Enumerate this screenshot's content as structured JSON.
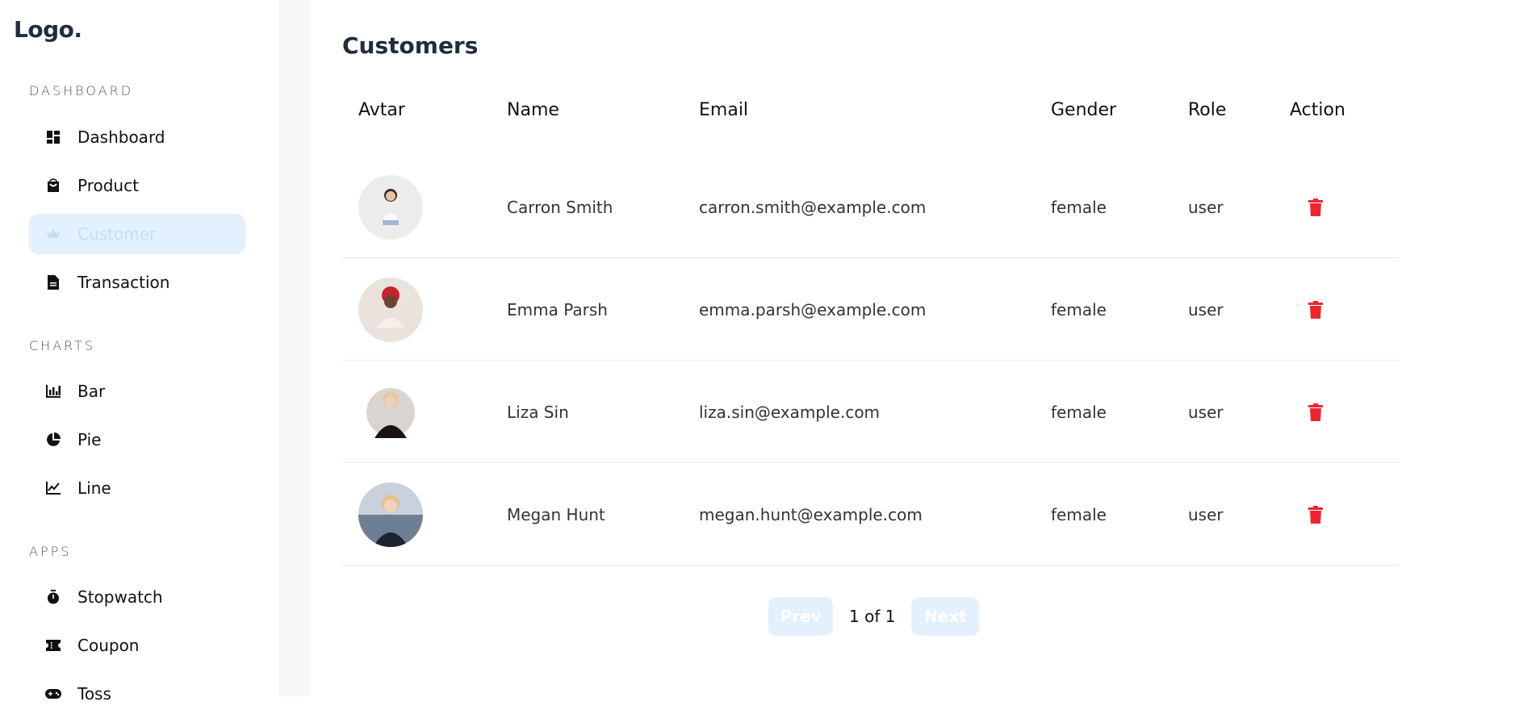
{
  "sidebar": {
    "logo": "Logo.",
    "sections": [
      {
        "heading": "DASHBOARD",
        "items": [
          {
            "label": "Dashboard",
            "icon": "dashboard-icon"
          },
          {
            "label": "Product",
            "icon": "shopping-bag-icon"
          },
          {
            "label": "Customer",
            "icon": "crown-icon",
            "active": true
          },
          {
            "label": "Transaction",
            "icon": "document-icon"
          }
        ]
      },
      {
        "heading": "CHARTS",
        "items": [
          {
            "label": "Bar",
            "icon": "bar-chart-icon"
          },
          {
            "label": "Pie",
            "icon": "pie-chart-icon"
          },
          {
            "label": "Line",
            "icon": "line-chart-icon"
          }
        ]
      },
      {
        "heading": "APPS",
        "items": [
          {
            "label": "Stopwatch",
            "icon": "stopwatch-icon"
          },
          {
            "label": "Coupon",
            "icon": "ticket-icon"
          },
          {
            "label": "Toss",
            "icon": "gamepad-icon"
          }
        ]
      }
    ]
  },
  "main": {
    "title": "Customers",
    "columns": [
      "Avtar",
      "Name",
      "Email",
      "Gender",
      "Role",
      "Action"
    ],
    "rows": [
      {
        "name": "Carron Smith",
        "email": "carron.smith@example.com",
        "gender": "female",
        "role": "user"
      },
      {
        "name": "Emma Parsh",
        "email": "emma.parsh@example.com",
        "gender": "female",
        "role": "user"
      },
      {
        "name": "Liza Sin",
        "email": "liza.sin@example.com",
        "gender": "female",
        "role": "user"
      },
      {
        "name": "Megan Hunt",
        "email": "megan.hunt@example.com",
        "gender": "female",
        "role": "user"
      }
    ],
    "pagination": {
      "prev": "Prev",
      "info": "1 of 1",
      "next": "Next"
    }
  },
  "colors": {
    "accent_bg": "#e3f0fd",
    "delete": "#f0262e",
    "heading": "#1f2d3d"
  }
}
